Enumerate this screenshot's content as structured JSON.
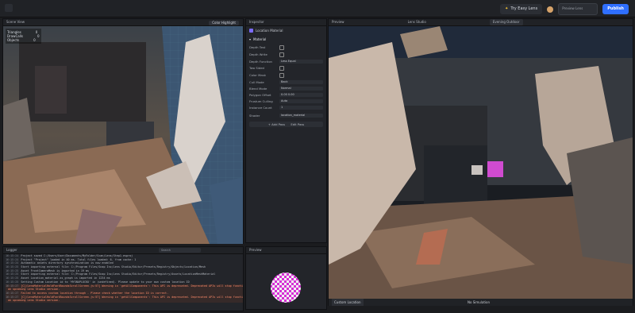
{
  "topbar": {
    "try_app": "Try Easy Lens",
    "search_placeholder": "Preview Lens",
    "publish": "Publish"
  },
  "scene_panel": {
    "title": "Scene View",
    "mode": "Color Highlight",
    "overlay_rows": [
      {
        "k": "Triangles",
        "v": "0"
      },
      {
        "k": "DrawCalls",
        "v": "0"
      },
      {
        "k": "Objects",
        "v": "0"
      }
    ]
  },
  "inspector": {
    "title": "Inspector",
    "material_name": "Location Material",
    "section": "Material",
    "props": [
      {
        "k": "Depth Test",
        "v": ""
      },
      {
        "k": "Depth Write",
        "v": ""
      },
      {
        "k": "Depth Function",
        "v": "Less Equal"
      },
      {
        "k": "Two Sided",
        "v": ""
      },
      {
        "k": "Color Mask",
        "v": ""
      },
      {
        "k": "Cull Mode",
        "v": "Back"
      },
      {
        "k": "Blend Mode",
        "v": "Normal"
      },
      {
        "k": "Polygon Offset",
        "v": "0.00   0.00"
      },
      {
        "k": "Frustum Culling",
        "v": "Auto"
      },
      {
        "k": "Instance Count",
        "v": "1"
      }
    ],
    "shader_label": "Shader",
    "shader_value": "location_material",
    "add_pass": "Add Pass",
    "edit_pass": "Edit Pass"
  },
  "preview3d": {
    "title": "Preview",
    "lens_title": "Lens Studio",
    "mode": "Evening Outdoor",
    "footer_left": "Custom Location",
    "footer_center": "No Simulation"
  },
  "console": {
    "title": "Logger",
    "search_placeholder": "Search",
    "lines": [
      {
        "t": "16:15:24",
        "msg": "Project saved C:/Users/User/Documents/MyFolder/Scan/Lens/Step1.esproj",
        "err": false
      },
      {
        "t": "16:15:24",
        "msg": "Project \"Project\" loaded in 40 ms. Total files loaded: 6. from cache: 1",
        "err": false
      },
      {
        "t": "16:15:24",
        "msg": "Automatic assets directory synchronization is now enabled",
        "err": false
      },
      {
        "t": "16:15:25",
        "msg": "Start importing external file: C:/Program Files/Snap Inc/Lens Studio/Editor/Presets/Registry/Objects/Location/Mesh",
        "err": false
      },
      {
        "t": "16:15:25",
        "msg": "Asset FrontCameraMesh is imported in 19 ms",
        "err": false
      },
      {
        "t": "16:15:25",
        "msg": "Start importing external file: C:/Program Files/Snap Inc/Lens Studio/Editor/Presets/Registry/Assets/LocationMeshMaterial",
        "err": false
      },
      {
        "t": "16:15:25",
        "msg": "Asset Location_material.ss_graph is imported in 1234 ms",
        "err": false
      },
      {
        "t": "16:15:25",
        "msg": "Setting Custom Location id to 'MYSNAPLOCKO' in (undefined). Please update to your own custom location ID",
        "err": false
      },
      {
        "t": "16:15:27",
        "msg": "[C]/LensMaterialHoldFontBoundsScrollScreen.js:57] Warning in 'getAllComponents': This API is deprecated. Deprecated APIs will stop functioning in",
        "err": true
      },
      {
        "t": "",
        "msg": "  an upcoming Lens Studio version.",
        "err": true
      },
      {
        "t": "16:15:27",
        "msg": "Failed to access custom location through . Please check whether the location ID is correct.",
        "err": true
      },
      {
        "t": "16:15:27",
        "msg": "[C]/LensMaterialHoldFontBoundsScrollScreen.js:57] Warning in 'getAllComponents': This API is deprecated. Deprecated APIs will stop functioning in",
        "err": true
      },
      {
        "t": "",
        "msg": "  an upcoming Lens Studio version.",
        "err": true
      }
    ]
  },
  "preview_panel": {
    "title": "Preview"
  }
}
